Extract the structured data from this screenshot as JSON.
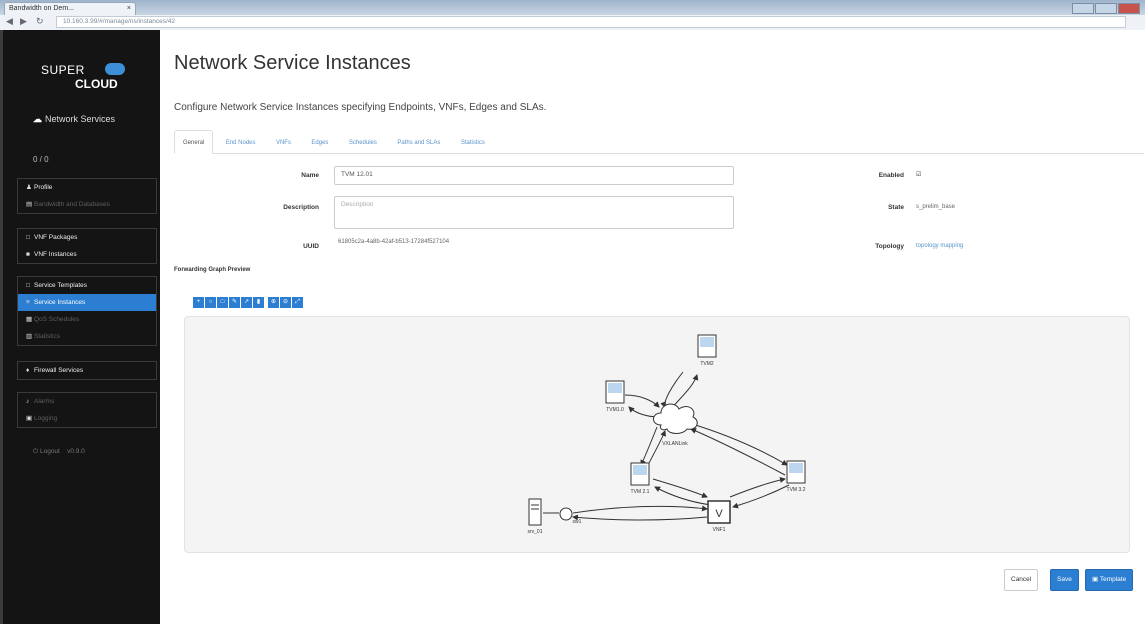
{
  "browser": {
    "tab_title": "Bandwidth on Dem...",
    "tab_close": "×",
    "url": "10.160.3.99/#/manage/ns/instances/42"
  },
  "sidebar": {
    "logo_line1": "SUPER",
    "logo_line2": "CLOUD",
    "section_title": "Network Services",
    "user": "0 / 0",
    "items": [
      {
        "label": "Profile",
        "icon": "user-icon",
        "enabled": true
      },
      {
        "label": "Bandwidth and Databases",
        "icon": "chart-icon",
        "enabled": false
      },
      {
        "label": "VNF Packages",
        "icon": "package-icon",
        "enabled": true
      },
      {
        "label": "VNF Instances",
        "icon": "server-icon",
        "enabled": true
      },
      {
        "label": "Service Templates",
        "icon": "template-icon",
        "enabled": true
      },
      {
        "label": "Service Instances",
        "icon": "list-icon",
        "enabled": true,
        "active": true
      },
      {
        "label": "QoS Schedules",
        "icon": "calendar-icon",
        "enabled": false
      },
      {
        "label": "Statistics",
        "icon": "stats-icon",
        "enabled": false
      },
      {
        "label": "Firewall Services",
        "icon": "fire-icon",
        "enabled": true
      },
      {
        "label": "Alarms",
        "icon": "bell-icon",
        "enabled": false
      },
      {
        "label": "Logging",
        "icon": "log-icon",
        "enabled": false
      }
    ],
    "logout": "Logout",
    "version": "v0.9.0"
  },
  "main": {
    "title": "Network Service Instances",
    "subtitle": "Configure Network Service Instances specifying Endpoints, VNFs, Edges and SLAs.",
    "tabs": [
      "General",
      "End Nodes",
      "VNFs",
      "Edges",
      "Schedules",
      "Paths and SLAs",
      "Statistics"
    ],
    "form": {
      "name_label": "Name",
      "name_value": "TVM 12.01",
      "description_label": "Description",
      "description_placeholder": "Description",
      "uuid_label": "UUID",
      "uuid_value": "61805c2a-4a8b-42af-b513-17284f527104",
      "enabled_label": "Enabled",
      "enabled_value": "☑",
      "state_label": "State",
      "state_value": "s_prelim_base",
      "topology_label": "Topology",
      "topology_value": "topology mapping"
    },
    "graph": {
      "title": "Forwarding Graph Preview",
      "toolbar_icons": [
        "plus-icon",
        "circle-icon",
        "square-icon",
        "edit-icon",
        "link-icon",
        "trash-icon",
        "zoom-in-icon",
        "zoom-out-icon",
        "fit-icon"
      ],
      "nodes": {
        "vm_top": "TVM2",
        "vm_left": "TVM1.0",
        "cloud": "VXLANLink",
        "vm_mid": "TVM 2.1",
        "vm_right": "TVM 3.2",
        "vnf": "VNF1",
        "server": "srv_01",
        "switch": "sw1"
      }
    },
    "buttons": {
      "cancel": "Cancel",
      "save": "Save",
      "template": "Template"
    }
  }
}
